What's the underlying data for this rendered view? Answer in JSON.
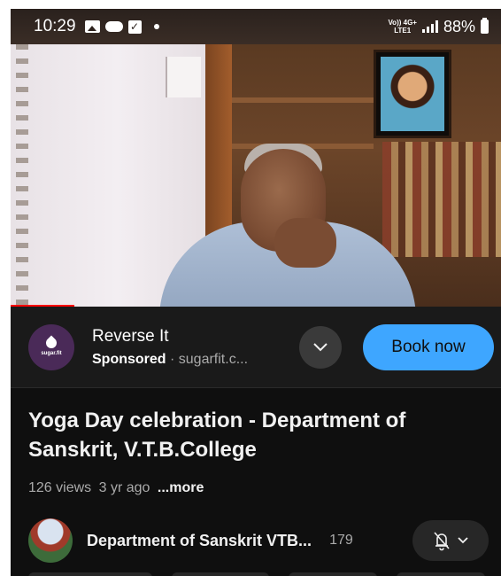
{
  "status_bar": {
    "time": "10:29",
    "left_icons": [
      "gallery-icon",
      "cloud-icon",
      "checkbox-icon",
      "dot-icon"
    ],
    "network_top": "Vo)) 4G+",
    "network_bottom": "LTE1",
    "battery": "88%"
  },
  "video": {
    "progress_fraction": 0.13,
    "progress_color": "#ff0000"
  },
  "ad": {
    "title": "Reverse It",
    "sponsored_label": "Sponsored",
    "separator": " · ",
    "domain": "sugarfit.c...",
    "logo_text": "sugar.fit",
    "cta_label": "Book now",
    "cta_color": "#3ea6ff"
  },
  "video_info": {
    "title": "Yoga Day celebration - Department of Sanskrit, V.T.B.College",
    "views": "126 views",
    "age": "3 yr ago",
    "more_label": "...more"
  },
  "channel": {
    "name": "Department of Sanskrit VTB...",
    "subscribers": "179",
    "bell_icon": "bell-off-icon",
    "dropdown_icon": "chevron-down-icon"
  }
}
